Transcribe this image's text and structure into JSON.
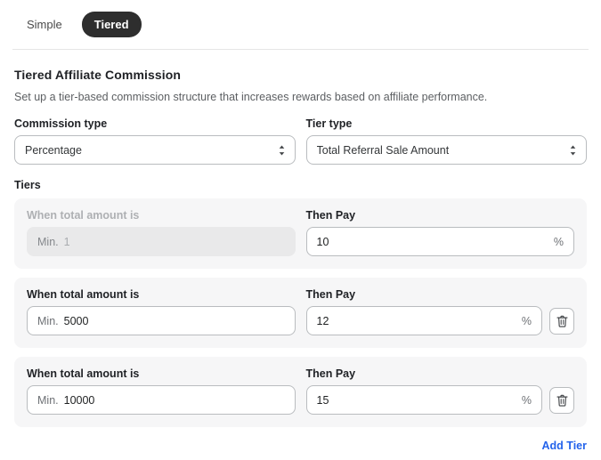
{
  "tabs": [
    {
      "label": "Simple",
      "active": false,
      "name": "tab-simple"
    },
    {
      "label": "Tiered",
      "active": true,
      "name": "tab-tiered"
    }
  ],
  "header": {
    "title": "Tiered Affiliate Commission",
    "description": "Set up a tier-based commission structure that increases rewards based on affiliate performance."
  },
  "commission_type": {
    "label": "Commission type",
    "value": "Percentage"
  },
  "tier_type": {
    "label": "Tier type",
    "value": "Total Referral Sale Amount"
  },
  "tiers_section": {
    "label": "Tiers",
    "amount_label": "When total amount is",
    "pay_label": "Then Pay",
    "min_prefix": "Min.",
    "percent_suffix": "%",
    "rows": [
      {
        "amount_label": "When total amount is",
        "pay_label": "Then Pay",
        "min_prefix": "Min.",
        "min_value": "1",
        "pay_value": "10",
        "percent_suffix": "%",
        "disabled": true,
        "deletable": false
      },
      {
        "amount_label": "When total amount is",
        "pay_label": "Then Pay",
        "min_prefix": "Min.",
        "min_value": "5000",
        "pay_value": "12",
        "percent_suffix": "%",
        "disabled": false,
        "deletable": true
      },
      {
        "amount_label": "When total amount is",
        "pay_label": "Then Pay",
        "min_prefix": "Min.",
        "min_value": "10000",
        "pay_value": "15",
        "percent_suffix": "%",
        "disabled": false,
        "deletable": true
      }
    ]
  },
  "footer": {
    "add_tier_label": "Add Tier"
  },
  "icons": {
    "select_chevrons": "chevron-up-down-icon",
    "delete": "trash-icon"
  },
  "colors": {
    "active_tab_bg": "#2e2e2e",
    "link": "#2463eb",
    "card_bg": "#f6f6f7",
    "disabled_input_bg": "#e9e9ea",
    "border": "#b9bcbf"
  }
}
